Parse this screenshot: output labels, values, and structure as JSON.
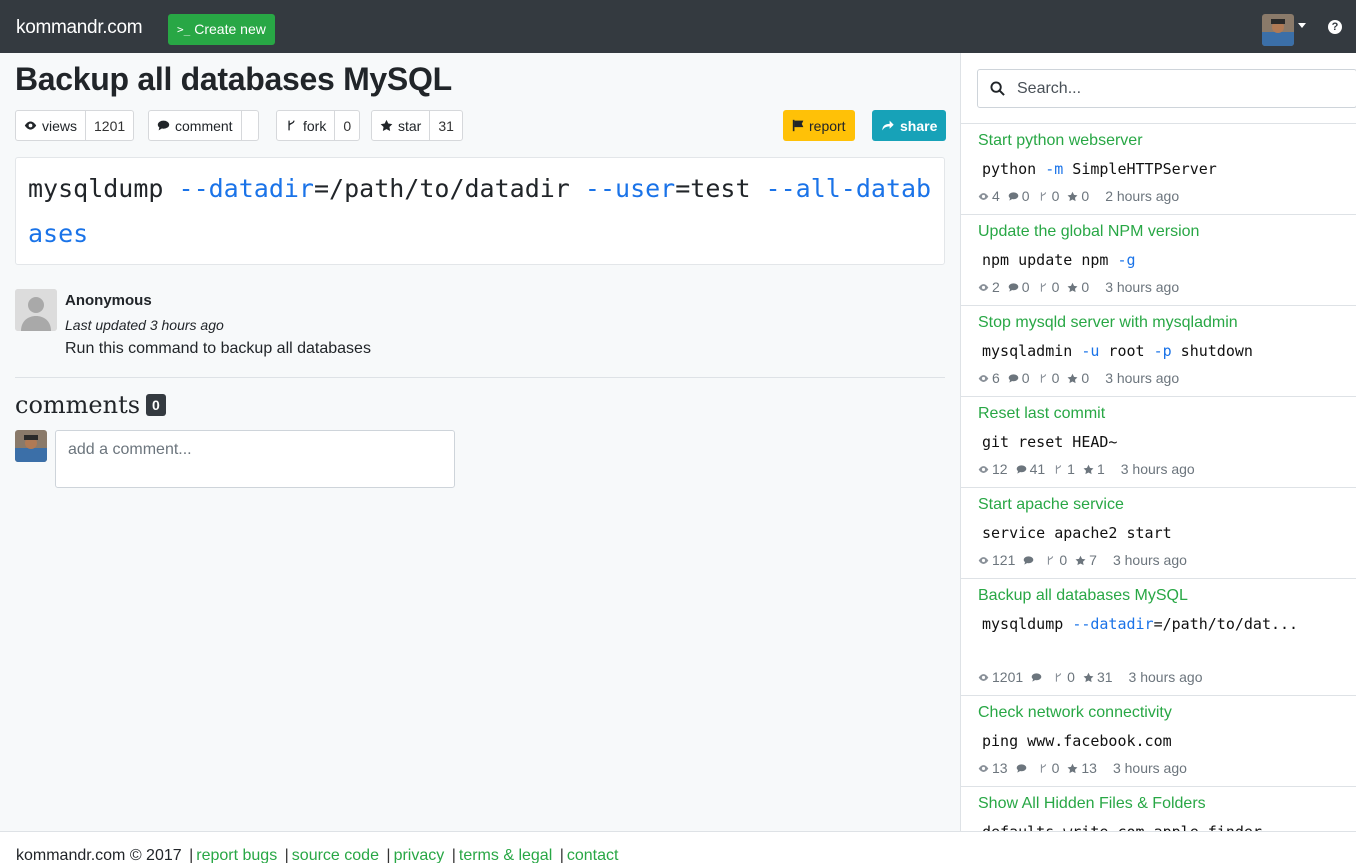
{
  "navbar": {
    "brand": "kommandr.com",
    "create_label": "Create new",
    "create_prompt": ">_"
  },
  "command": {
    "title": "Backup all databases MySQL",
    "stats": {
      "views_label": "views",
      "views": "1201",
      "comment_label": "comment",
      "comments": "",
      "fork_label": "fork",
      "forks": "0",
      "star_label": "star",
      "stars": "31"
    },
    "report_label": "report",
    "share_label": "share",
    "code_parts": [
      {
        "text": "mysqldump ",
        "flag": false
      },
      {
        "text": "--datadir",
        "flag": true
      },
      {
        "text": "=/path/to/datadir ",
        "flag": false
      },
      {
        "text": "--user",
        "flag": true
      },
      {
        "text": "=test ",
        "flag": false
      },
      {
        "text": "--all-databases",
        "flag": true
      }
    ],
    "author": "Anonymous",
    "updated": "Last updated 3 hours ago",
    "description": "Run this command to backup all databases"
  },
  "comments": {
    "title": "comments",
    "count": "0",
    "placeholder": "add a comment..."
  },
  "sidebar": {
    "search_placeholder": "Search...",
    "items": [
      {
        "title": "Start python webserver",
        "snippet": [
          {
            "text": "python ",
            "flag": false
          },
          {
            "text": "-m",
            "flag": true
          },
          {
            "text": " SimpleHTTPServer",
            "flag": false
          }
        ],
        "views": "4",
        "comments": "0",
        "forks": "0",
        "stars": "0",
        "ago": "2 hours ago",
        "tall": false
      },
      {
        "title": "Update the global NPM version",
        "snippet": [
          {
            "text": "npm update npm ",
            "flag": false
          },
          {
            "text": "-g",
            "flag": true
          }
        ],
        "views": "2",
        "comments": "0",
        "forks": "0",
        "stars": "0",
        "ago": "3 hours ago",
        "tall": false
      },
      {
        "title": "Stop mysqld server with mysqladmin",
        "snippet": [
          {
            "text": "mysqladmin ",
            "flag": false
          },
          {
            "text": "-u",
            "flag": true
          },
          {
            "text": " root ",
            "flag": false
          },
          {
            "text": "-p",
            "flag": true
          },
          {
            "text": " shutdown",
            "flag": false
          }
        ],
        "views": "6",
        "comments": "0",
        "forks": "0",
        "stars": "0",
        "ago": "3 hours ago",
        "tall": false
      },
      {
        "title": "Reset last commit",
        "snippet": [
          {
            "text": "git reset HEAD~",
            "flag": false
          }
        ],
        "views": "12",
        "comments": "41",
        "forks": "1",
        "stars": "1",
        "ago": "3 hours ago",
        "tall": false
      },
      {
        "title": "Start apache service",
        "snippet": [
          {
            "text": "service apache2 start",
            "flag": false
          }
        ],
        "views": "121",
        "comments": "",
        "forks": "0",
        "stars": "7",
        "ago": "3 hours ago",
        "tall": false
      },
      {
        "title": "Backup all databases MySQL",
        "snippet": [
          {
            "text": "mysqldump ",
            "flag": false
          },
          {
            "text": "--datadir",
            "flag": true
          },
          {
            "text": "=/path/to/dat...",
            "flag": false
          }
        ],
        "views": "1201",
        "comments": "",
        "forks": "0",
        "stars": "31",
        "ago": "3 hours ago",
        "tall": true
      },
      {
        "title": "Check network connectivity",
        "snippet": [
          {
            "text": "ping www.facebook.com",
            "flag": false
          }
        ],
        "views": "13",
        "comments": "",
        "forks": "0",
        "stars": "13",
        "ago": "3 hours ago",
        "tall": false
      },
      {
        "title": "Show All Hidden Files & Folders",
        "snippet": [
          {
            "text": "defaults write com.apple.finder",
            "flag": false
          }
        ],
        "views": "",
        "comments": "",
        "forks": "",
        "stars": "",
        "ago": "",
        "tall": false
      }
    ]
  },
  "footer": {
    "copyright": "kommandr.com © 2017",
    "links": [
      "report bugs",
      "source code",
      "privacy",
      "terms & legal",
      "contact"
    ]
  },
  "colors": {
    "navbar": "#343a40",
    "accent_green": "#28a745",
    "flag_blue": "#1a73e8",
    "report_yellow": "#ffc107",
    "share_teal": "#17a2b8"
  },
  "icons": {
    "views": "eye-icon",
    "comment": "comment-icon",
    "fork": "fork-icon",
    "star": "star-icon",
    "report": "flag-icon",
    "share": "share-icon",
    "search": "search-icon",
    "help": "help-icon"
  }
}
